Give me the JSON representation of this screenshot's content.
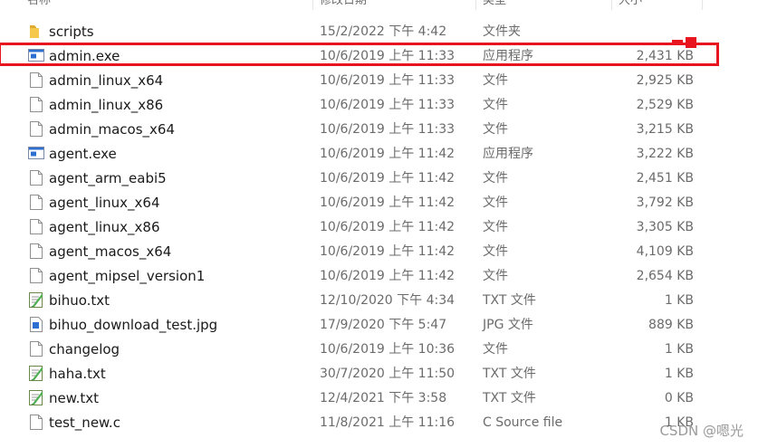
{
  "header": {
    "col_name": "名称",
    "col_date": "修改日期",
    "col_type": "类型",
    "col_size": "大小"
  },
  "files": [
    {
      "name": "scripts",
      "date": "15/2/2022 下午 4:42",
      "type": "文件夹",
      "size": "",
      "icon": "folder-icon"
    },
    {
      "name": "admin.exe",
      "date": "10/6/2019 上午 11:33",
      "type": "应用程序",
      "size": "2,431 KB",
      "icon": "application-icon"
    },
    {
      "name": "admin_linux_x64",
      "date": "10/6/2019 上午 11:33",
      "type": "文件",
      "size": "2,925 KB",
      "icon": "file-icon"
    },
    {
      "name": "admin_linux_x86",
      "date": "10/6/2019 上午 11:33",
      "type": "文件",
      "size": "2,529 KB",
      "icon": "file-icon"
    },
    {
      "name": "admin_macos_x64",
      "date": "10/6/2019 上午 11:33",
      "type": "文件",
      "size": "3,215 KB",
      "icon": "file-icon"
    },
    {
      "name": "agent.exe",
      "date": "10/6/2019 上午 11:42",
      "type": "应用程序",
      "size": "3,222 KB",
      "icon": "application-icon"
    },
    {
      "name": "agent_arm_eabi5",
      "date": "10/6/2019 上午 11:42",
      "type": "文件",
      "size": "2,451 KB",
      "icon": "file-icon"
    },
    {
      "name": "agent_linux_x64",
      "date": "10/6/2019 上午 11:42",
      "type": "文件",
      "size": "3,792 KB",
      "icon": "file-icon"
    },
    {
      "name": "agent_linux_x86",
      "date": "10/6/2019 上午 11:42",
      "type": "文件",
      "size": "3,305 KB",
      "icon": "file-icon"
    },
    {
      "name": "agent_macos_x64",
      "date": "10/6/2019 上午 11:42",
      "type": "文件",
      "size": "4,109 KB",
      "icon": "file-icon"
    },
    {
      "name": "agent_mipsel_version1",
      "date": "10/6/2019 上午 11:42",
      "type": "文件",
      "size": "2,654 KB",
      "icon": "file-icon"
    },
    {
      "name": "bihuo.txt",
      "date": "12/10/2020 下午 4:34",
      "type": "TXT 文件",
      "size": "1 KB",
      "icon": "text-file-icon"
    },
    {
      "name": "bihuo_download_test.jpg",
      "date": "17/9/2020 下午 5:47",
      "type": "JPG 文件",
      "size": "889 KB",
      "icon": "image-file-icon"
    },
    {
      "name": "changelog",
      "date": "10/6/2019 上午 10:36",
      "type": "文件",
      "size": "1 KB",
      "icon": "file-icon"
    },
    {
      "name": "haha.txt",
      "date": "30/7/2020 上午 11:50",
      "type": "TXT 文件",
      "size": "1 KB",
      "icon": "text-file-icon"
    },
    {
      "name": "new.txt",
      "date": "12/4/2021 下午 3:58",
      "type": "TXT 文件",
      "size": "0 KB",
      "icon": "text-file-icon"
    },
    {
      "name": "test_new.c",
      "date": "11/8/2021 上午 11:16",
      "type": "C Source file",
      "size": "1 KB",
      "icon": "file-icon"
    }
  ],
  "highlighted_file": "admin.exe",
  "watermark": "CSDN @嗯光",
  "colors": {
    "highlight": "#e8141e",
    "folder": "#f3c44b",
    "text_primary": "#1a1a1a",
    "text_secondary": "#6b6b6b"
  }
}
